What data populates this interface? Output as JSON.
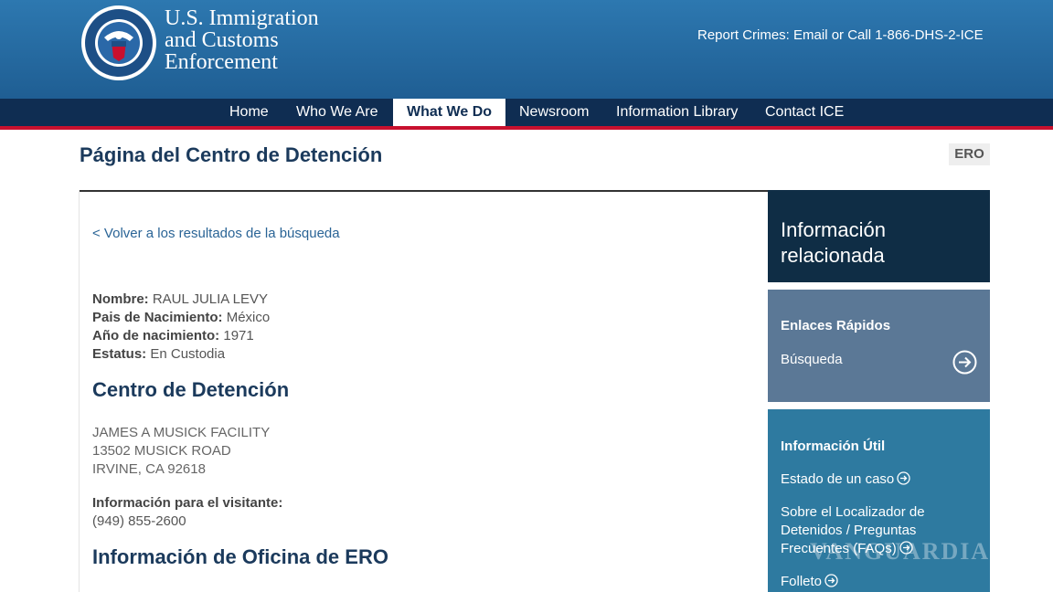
{
  "header": {
    "agency_line1": "U.S. Immigration",
    "agency_line2": "and Customs",
    "agency_line3": "Enforcement",
    "report_crimes": "Report Crimes: Email or Call 1-866-DHS-2-ICE",
    "seal_icon": "dhs-seal-icon"
  },
  "nav": {
    "items": [
      {
        "label": "Home"
      },
      {
        "label": "Who We Are"
      },
      {
        "label": "What We Do"
      },
      {
        "label": "Newsroom"
      },
      {
        "label": "Information Library"
      },
      {
        "label": "Contact ICE"
      }
    ],
    "active": "What We Do"
  },
  "page": {
    "title": "Página del Centro de Detención",
    "badge": "ERO"
  },
  "main": {
    "back_link": "< Volver a los resultados de la búsqueda",
    "details": [
      {
        "label": "Nombre:",
        "value": "RAUL JULIA LEVY"
      },
      {
        "label": "Pais de Nacimiento:",
        "value": "México"
      },
      {
        "label": "Año de nacimiento:",
        "value": "1971"
      },
      {
        "label": "Estatus:",
        "value": "En Custodia"
      }
    ],
    "facility_heading": "Centro de Detención",
    "address": [
      "JAMES A MUSICK FACILITY",
      "13502 MUSICK ROAD",
      "IRVINE, CA 92618"
    ],
    "visitor_label": "Información para el visitante:",
    "visitor_phone": "(949) 855-2600",
    "office_heading": "Información de Oficina de ERO"
  },
  "sidebar": {
    "heading": "Información relacionada",
    "quick_links_label": "Enlaces Rápidos",
    "search_link": "Búsqueda",
    "useful_label": "Información Útil",
    "links": [
      "Estado de un caso",
      "Sobre el Localizador de Detenidos / Preguntas Frecuentes (FAQs)",
      "Folleto"
    ]
  },
  "watermark": "VANGUARDIA",
  "colors": {
    "header_blue": "#2d78b0",
    "nav_navy": "#0f2d52",
    "accent_red": "#c8102e",
    "sidebar_dark": "#0f2d45",
    "sidebar_slate": "#5b7896",
    "sidebar_teal": "#2e7aa0"
  }
}
